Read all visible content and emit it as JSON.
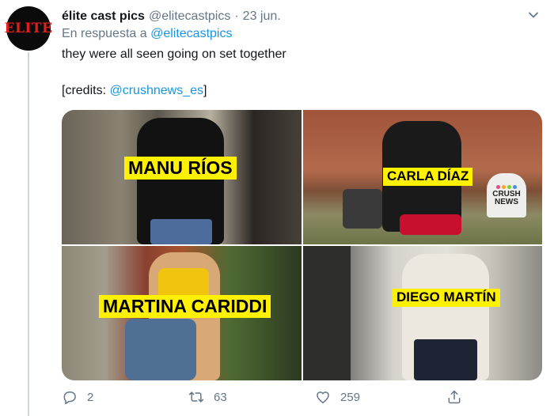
{
  "tweet": {
    "avatar_text": "ELITE",
    "display_name": "élite cast pics",
    "handle": "@elitecastpics",
    "separator": "·",
    "date": "23 jun.",
    "reply_prefix": "En respuesta a",
    "reply_to": "@elitecastpics",
    "text": "they were all seen going on set together",
    "credits_open": "[credits: ",
    "credits_handle": "@crushnews_es",
    "credits_close": "]"
  },
  "media": {
    "photos": [
      {
        "label": "MANU RÍOS"
      },
      {
        "label": "CARLA DÍAZ"
      },
      {
        "label": "MARTINA CARIDDI"
      },
      {
        "label": "DIEGO MARTÍN"
      }
    ],
    "watermark_line1": "CRUSH",
    "watermark_line2": "NEWS"
  },
  "actions": {
    "reply_count": "2",
    "retweet_count": "63",
    "like_count": "259"
  },
  "icons": {
    "caret": "chevron-down-icon",
    "reply": "reply-icon",
    "retweet": "retweet-icon",
    "like": "heart-icon",
    "share": "share-icon"
  },
  "colors": {
    "link": "#1b95e0",
    "secondary_text": "#657786",
    "label_bg": "#fff100",
    "avatar_brand": "#e0201c"
  }
}
